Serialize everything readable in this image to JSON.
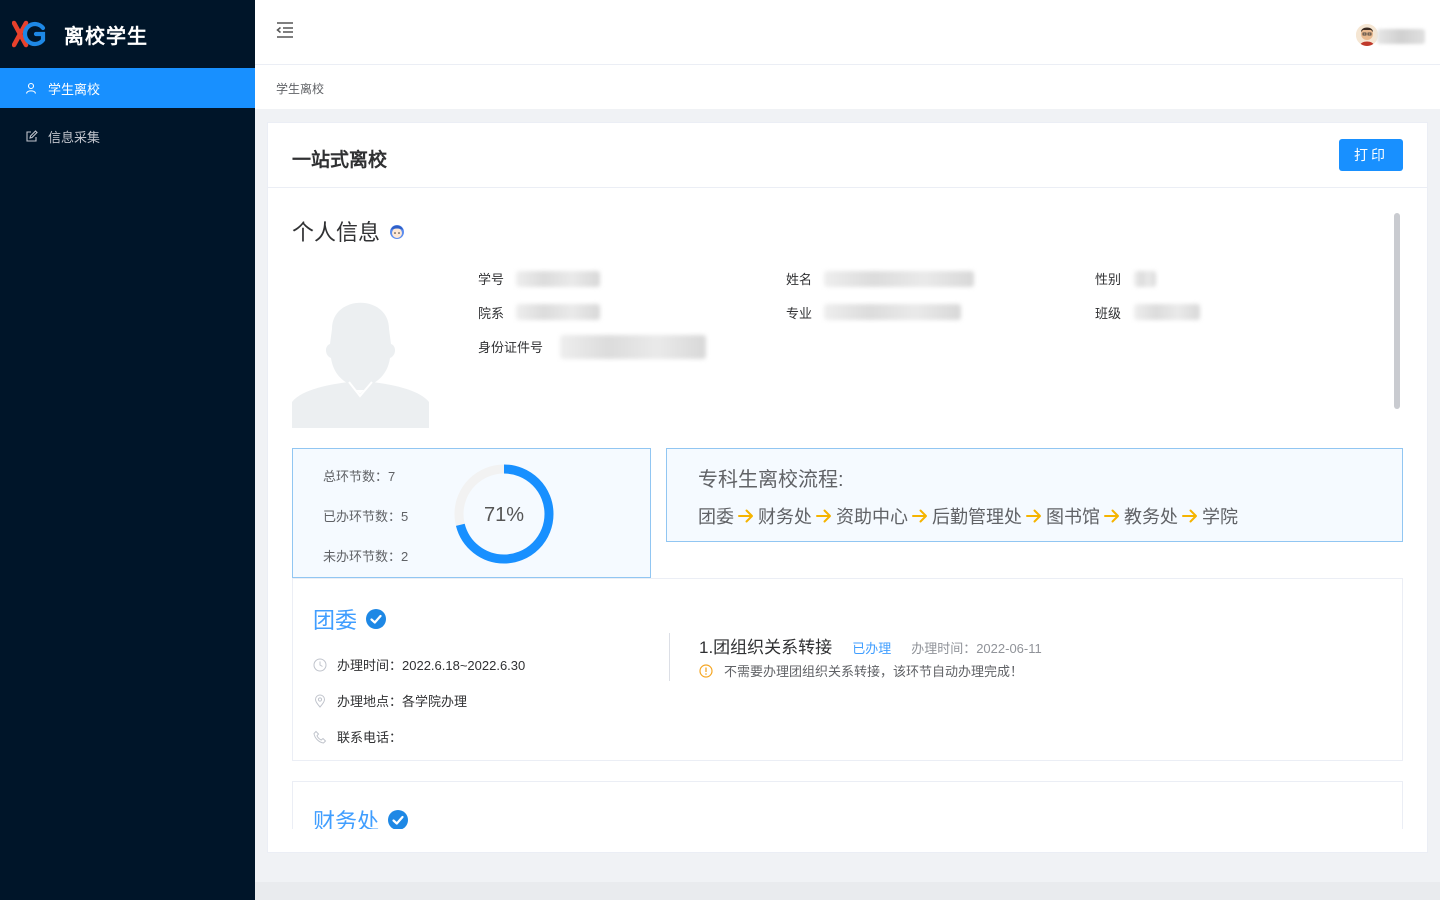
{
  "app": {
    "title": "离校学生"
  },
  "sidebar": {
    "items": [
      {
        "label": "学生离校",
        "icon": "user-icon",
        "active": true
      },
      {
        "label": "信息采集",
        "icon": "edit-icon",
        "active": false
      }
    ]
  },
  "breadcrumb": {
    "current": "学生离校"
  },
  "page": {
    "title": "一站式离校",
    "print_label": "打印"
  },
  "personal": {
    "section_title": "个人信息",
    "fields": {
      "student_no": "学号",
      "name": "姓名",
      "gender": "性别",
      "department": "院系",
      "major": "专业",
      "class": "班级",
      "id_card": "身份证件号"
    }
  },
  "stats": {
    "total": "总环节数：7",
    "done": "已办环节数：5",
    "pending": "未办环节数：2",
    "percent_label": "71%",
    "percent": 71,
    "ring_color": "#1890ff",
    "track_color": "#f2f2f2"
  },
  "flow": {
    "title": "专科生离校流程:",
    "steps": [
      "团委",
      "财务处",
      "资助中心",
      "后勤管理处",
      "图书馆",
      "教务处",
      "学院"
    ],
    "arrow_color": "#f5b400"
  },
  "departments": [
    {
      "name": "团委",
      "time": "办理时间：2022.6.18~2022.6.30",
      "place": "办理地点：各学院办理",
      "phone": "联系电话：",
      "task": {
        "name": "1.团组织关系转接",
        "status": "已办理",
        "time": "办理时间：2022-06-11",
        "note": "不需要办理团组织关系转接，该环节自动办理完成！"
      }
    },
    {
      "name": "财务处"
    }
  ],
  "colors": {
    "primary": "#1890ff",
    "sidebar_bg": "#001529",
    "link": "#409eff"
  }
}
